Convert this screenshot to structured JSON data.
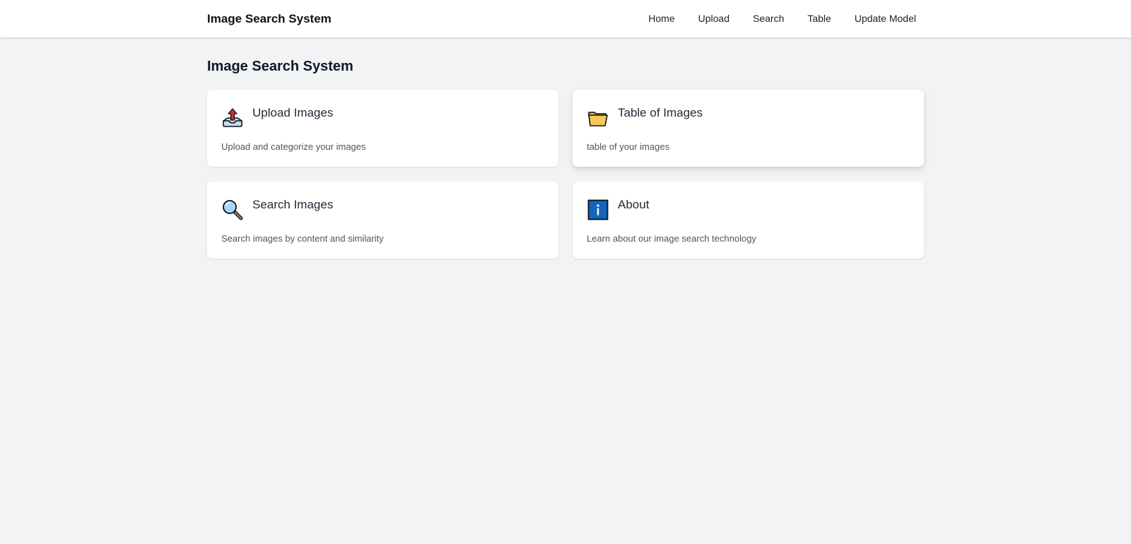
{
  "navbar": {
    "brand": "Image Search System",
    "links": [
      {
        "label": "Home"
      },
      {
        "label": "Upload"
      },
      {
        "label": "Search"
      },
      {
        "label": "Table"
      },
      {
        "label": "Update Model"
      }
    ]
  },
  "main": {
    "title": "Image Search System",
    "cards": [
      {
        "icon": "upload-tray-icon",
        "title": "Upload Images",
        "description": "Upload and categorize your images"
      },
      {
        "icon": "folder-icon",
        "title": "Table of Images",
        "description": "table of your images"
      },
      {
        "icon": "magnifier-icon",
        "title": "Search Images",
        "description": "Search images by content and similarity"
      },
      {
        "icon": "info-icon",
        "title": "About",
        "description": "Learn about our image search technology"
      }
    ]
  },
  "colors": {
    "page_background": "#f2f3f5",
    "card_background": "#ffffff",
    "info_blue": "#1565c0",
    "folder_yellow": "#f7c75a",
    "upload_arrow_red": "#d32f2f"
  }
}
